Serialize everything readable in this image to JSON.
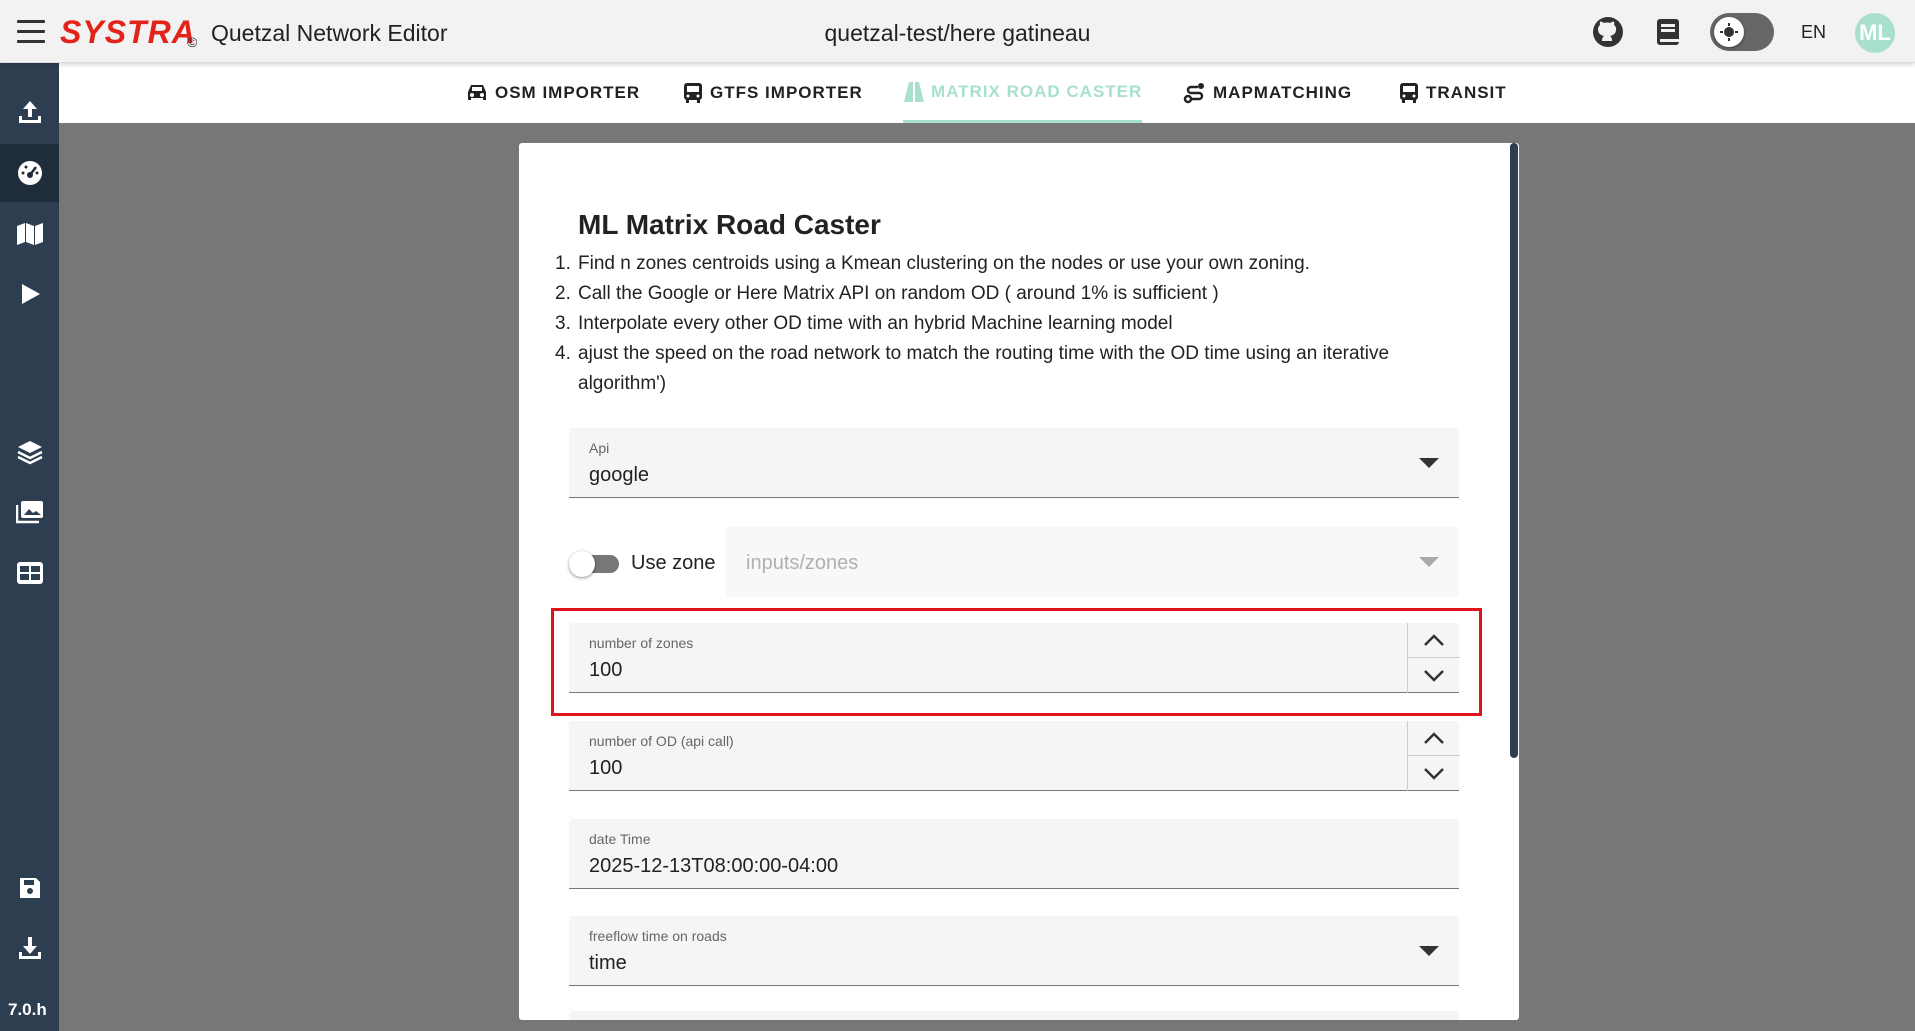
{
  "appbar": {
    "brand": "SYSTRA",
    "copyright": "©",
    "app_title": "Quetzal Network Editor",
    "project": "quetzal-test/here gatineau",
    "language": "EN",
    "avatar_initials": "ML"
  },
  "sidebar": {
    "version": "7.0.h",
    "items": [
      {
        "name": "import",
        "icon": "upload-icon"
      },
      {
        "name": "dashboard",
        "icon": "speedometer-icon",
        "active": true
      },
      {
        "name": "map",
        "icon": "map-icon"
      },
      {
        "name": "run",
        "icon": "play-icon"
      },
      {
        "name": "layers",
        "icon": "layers-icon"
      },
      {
        "name": "results",
        "icon": "images-icon"
      },
      {
        "name": "tables",
        "icon": "table-icon"
      },
      {
        "name": "save",
        "icon": "save-icon"
      },
      {
        "name": "export",
        "icon": "download-icon"
      }
    ]
  },
  "tabs": [
    {
      "label": "OSM IMPORTER",
      "icon": "car-icon"
    },
    {
      "label": "GTFS IMPORTER",
      "icon": "bus-icon"
    },
    {
      "label": "MATRIX ROAD CASTER",
      "icon": "road-icon",
      "active": true
    },
    {
      "label": "MAPMATCHING",
      "icon": "route-icon"
    },
    {
      "label": "TRANSIT",
      "icon": "bus-icon"
    }
  ],
  "form": {
    "title": "ML Matrix Road Caster",
    "steps": [
      {
        "num": "1.",
        "text": "Find n zones centroids using a Kmean clustering on the nodes or use your own zoning."
      },
      {
        "num": "2.",
        "text": "Call the Google or Here Matrix API on random OD ( around 1% is sufficient )"
      },
      {
        "num": "3.",
        "text": "Interpolate every other OD time with an hybrid Machine learning model"
      },
      {
        "num": "4.",
        "text": "ajust the speed on the road network to match the routing time with the OD time using an iterative algorithm')"
      }
    ],
    "api": {
      "label": "Api",
      "value": "google"
    },
    "use_zone": {
      "label": "Use zone",
      "enabled": false,
      "placeholder": "inputs/zones"
    },
    "num_zones": {
      "label": "number of zones",
      "value": "100"
    },
    "num_od": {
      "label": "number of OD (api call)",
      "value": "100"
    },
    "date_time": {
      "label": "date Time",
      "value": "2025-12-13T08:00:00-04:00"
    },
    "freeflow": {
      "label": "freeflow time on roads",
      "value": "time"
    }
  },
  "colors": {
    "sidebar": "#2d3e50",
    "accent": "#a8e0cc",
    "brand": "#e2231a",
    "highlight": "#e0131c"
  }
}
